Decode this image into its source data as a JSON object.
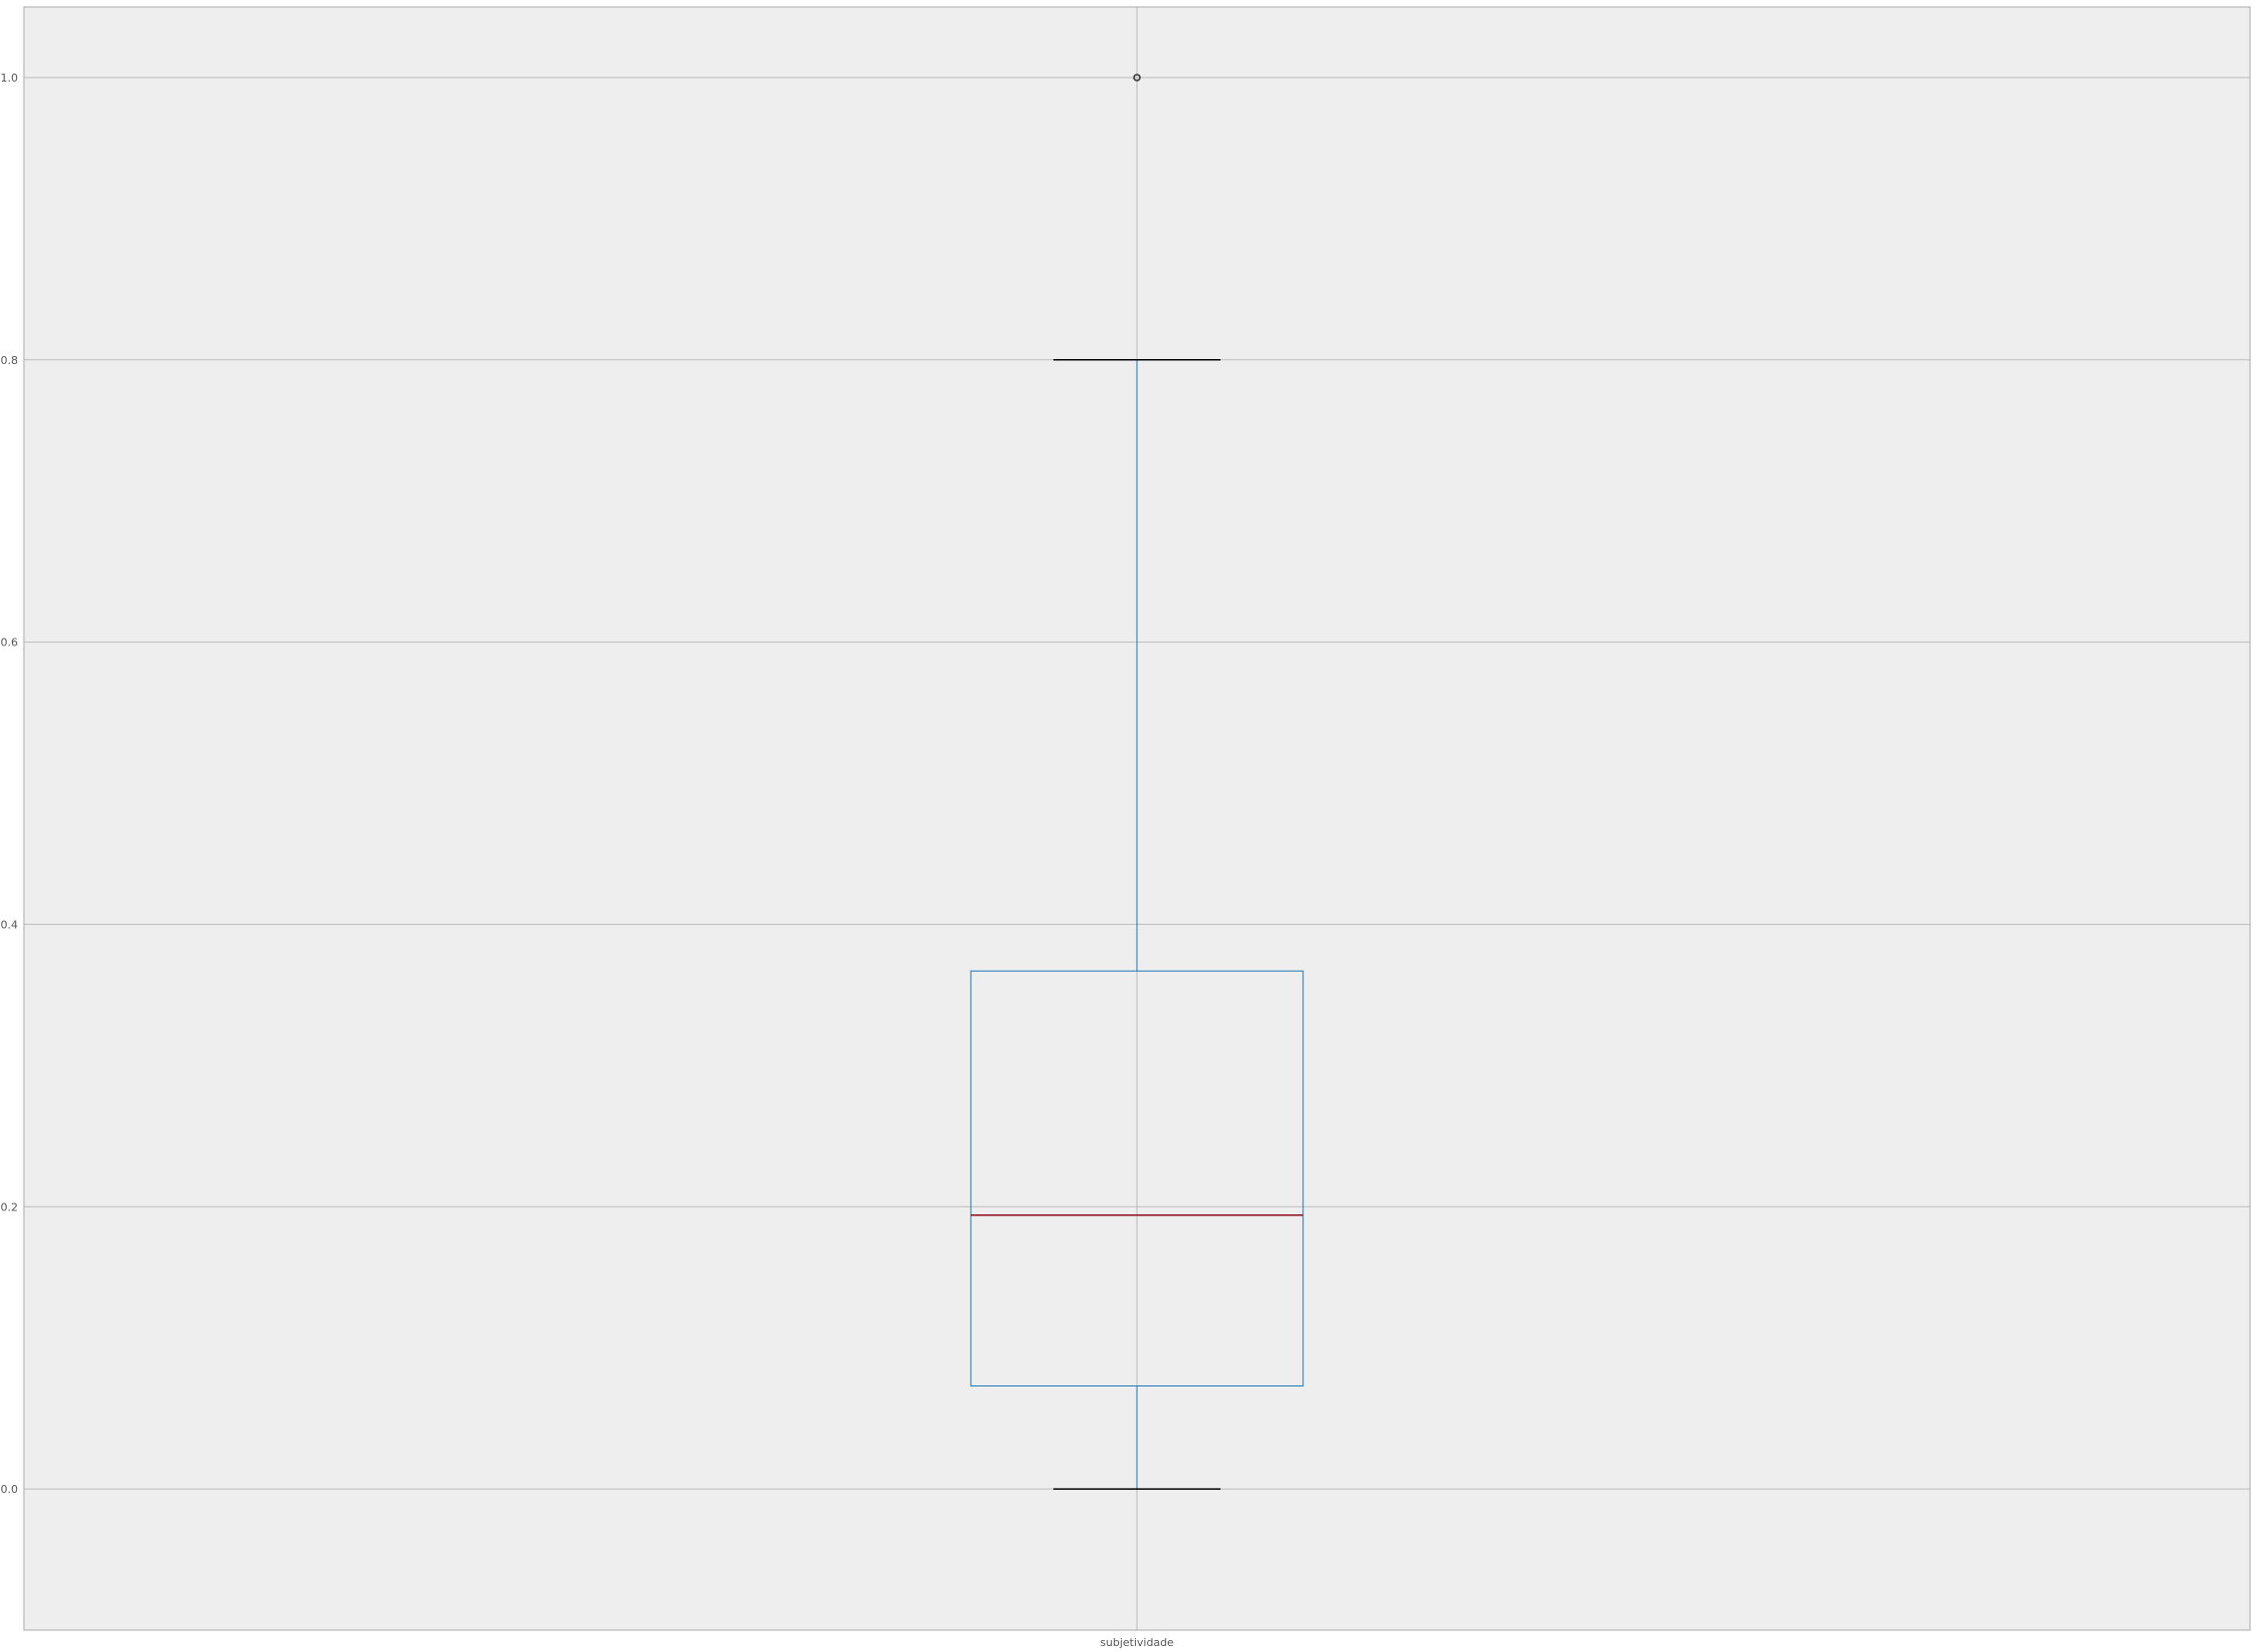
{
  "chart_data": {
    "type": "box",
    "title": "",
    "xlabel": "",
    "ylabel": "",
    "ylim": [
      -0.1,
      1.05
    ],
    "y_ticks": [
      {
        "value": 0.0,
        "label": "0.0"
      },
      {
        "value": 0.2,
        "label": "0.2"
      },
      {
        "value": 0.4,
        "label": "0.4"
      },
      {
        "value": 0.6,
        "label": "0.6"
      },
      {
        "value": 0.8,
        "label": "0.8"
      },
      {
        "value": 1.0,
        "label": "1.0"
      }
    ],
    "categories": [
      "subjetividade"
    ],
    "boxes": [
      {
        "category": "subjetividade",
        "whisker_low": 0.0,
        "q1": 0.073,
        "median": 0.194,
        "q3": 0.367,
        "whisker_high": 0.8,
        "outliers": [
          1.0
        ]
      }
    ],
    "grid": true,
    "colors": {
      "background": "#eeeeee",
      "grid": "#bbbbbb",
      "box": "#1f77b4",
      "median": "#8b0a1a",
      "caps": "#000000",
      "outlier": "#333333",
      "frame": "#aaaaaa"
    }
  }
}
